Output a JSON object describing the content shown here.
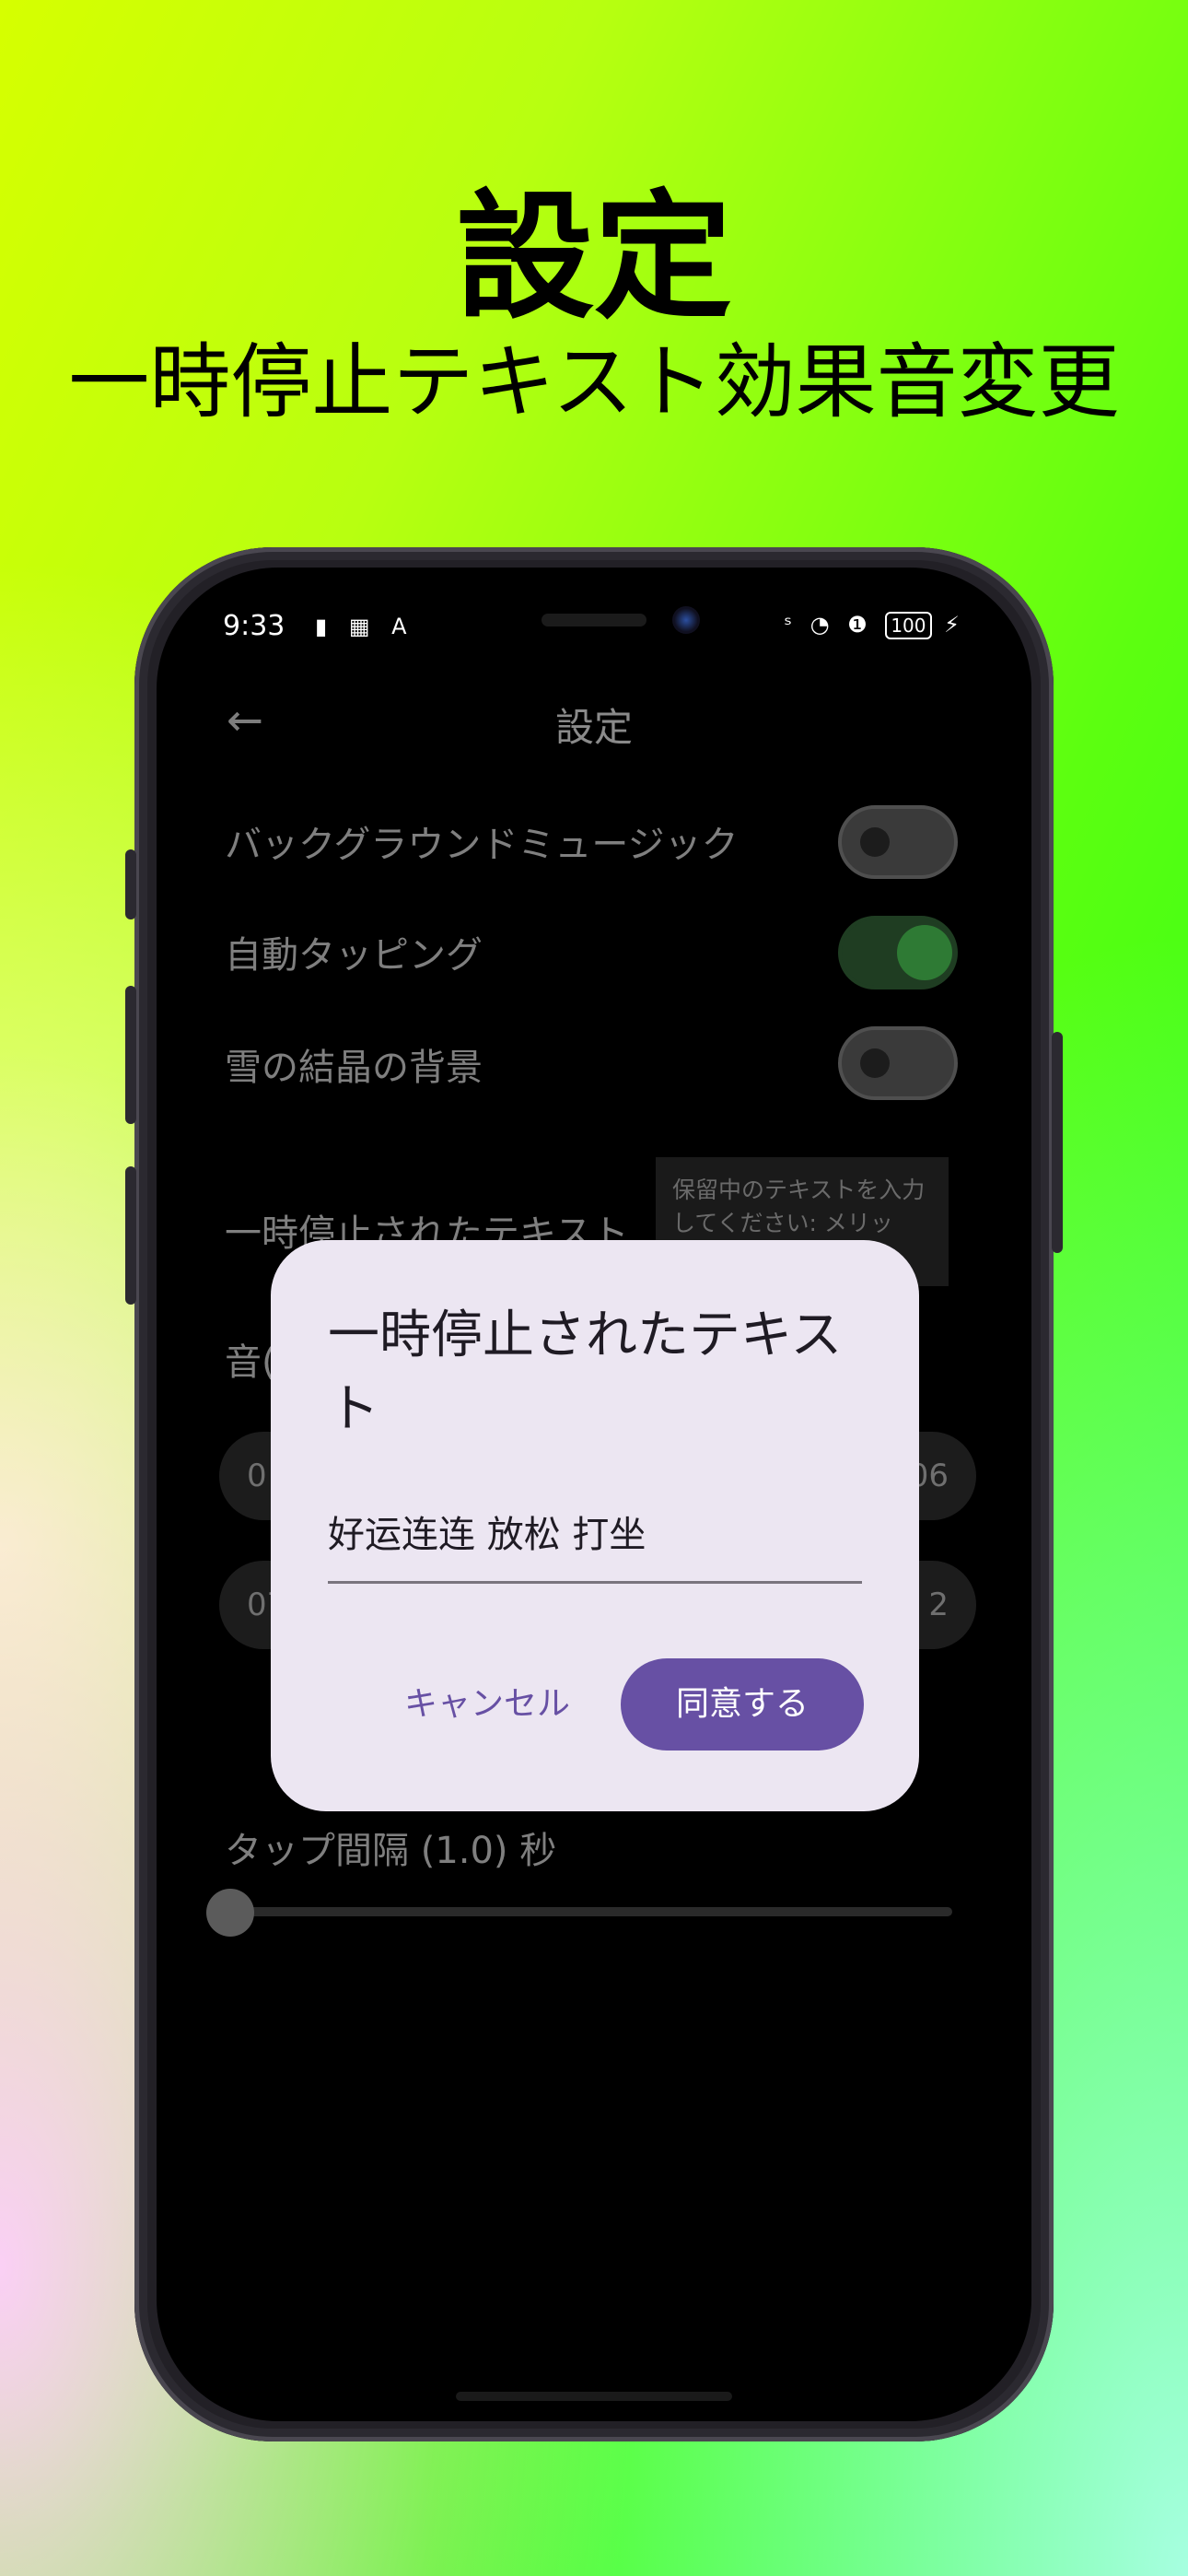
{
  "headline": {
    "title": "設定",
    "subtitle": "一時停止テキスト効果音変更"
  },
  "status_bar": {
    "time": "9:33",
    "left_icons": "▮ ▦ A",
    "right_icons": "ˢ ◔ ❶",
    "battery": "100",
    "charging": "⚡"
  },
  "app_bar": {
    "back_icon": "←",
    "title": "設定"
  },
  "settings": {
    "background_music": {
      "label": "バックグラウンドミュージック",
      "enabled": false
    },
    "auto_tapping": {
      "label": "自動タッピング",
      "enabled": true
    },
    "snow_background": {
      "label": "雪の結晶の背景",
      "enabled": false
    },
    "paused_text": {
      "label": "一時停止されたテキスト",
      "preview": "保留中のテキストを入力してください: メリッ"
    },
    "sound_label_partial": "音(",
    "chips": [
      "0",
      "06",
      "07",
      "2"
    ],
    "tap_interval": {
      "label": "タップ間隔 (1.0) 秒",
      "value_fraction": 0.0
    }
  },
  "dialog": {
    "title": "一時停止されたテキスト",
    "input_value": "好运连连 放松 打坐",
    "cancel_label": "キャンセル",
    "confirm_label": "同意する"
  }
}
